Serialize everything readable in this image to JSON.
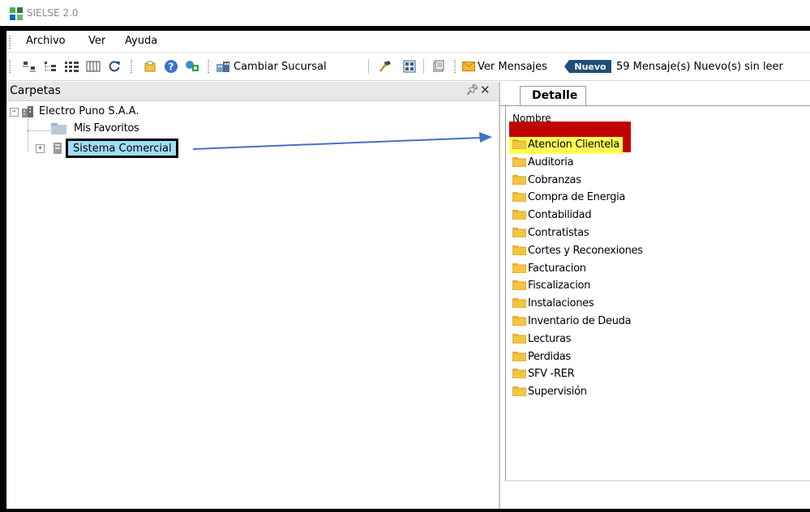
{
  "window": {
    "title": "SIELSE 2.0"
  },
  "menu": {
    "items": [
      "Archivo",
      "Ver",
      "Ayuda"
    ]
  },
  "toolbar": {
    "cambiar_sucursal": "Cambiar Sucursal",
    "ver_mensajes": "Ver Mensajes",
    "nuevo_badge": "Nuevo",
    "messages_status": "59 Mensaje(s) Nuevo(s) sin leer"
  },
  "left_panel": {
    "title": "Carpetas",
    "tree": {
      "root": "Electro Puno S.A.A.",
      "favorites": "Mis Favoritos",
      "selected": "Sistema Comercial"
    }
  },
  "right_panel": {
    "tab": "Detalle",
    "column_header": "Nombre",
    "folders": [
      "Atencion Clientela",
      "Auditoria",
      "Cobranzas",
      "Compra de Energia",
      "Contabilidad",
      "Contratistas",
      "Cortes y Reconexiones",
      "Facturacion",
      "Fiscalizacion",
      "Instalaciones",
      "Inventario de Deuda",
      "Lecturas",
      "Perdidas",
      "SFV -RER",
      "Supervisión"
    ]
  },
  "colors": {
    "selection_fill": "#9fdcf7",
    "annotation_red": "#c00000",
    "annotation_yellow": "#ffff55",
    "arrow_blue": "#4472c4",
    "folder_yellow": "#f4c542",
    "nuevo_badge": "#1f4e79"
  }
}
